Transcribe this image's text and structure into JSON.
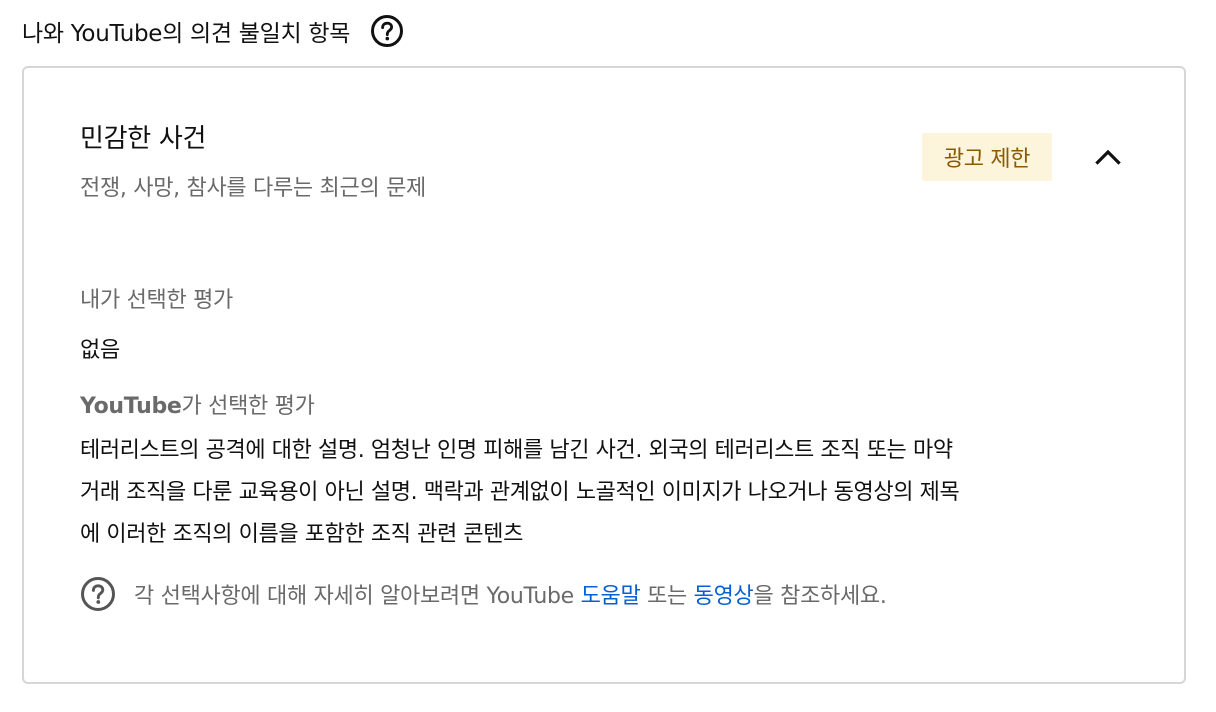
{
  "header": {
    "title": "나와 YouTube의 의견 불일치 항목",
    "help_icon": "help-circle-icon"
  },
  "issue": {
    "title": "민감한 사건",
    "subtitle": "전쟁, 사망, 참사를 다루는 최근의 문제",
    "status_badge": "광고 제한",
    "status_color": "#8a5a00",
    "status_bg": "#fdf4dc",
    "collapse_icon": "chevron-up-icon"
  },
  "my_rating": {
    "label": "내가 선택한 평가",
    "value": "없음"
  },
  "youtube_rating": {
    "label_strong": "YouTube",
    "label_rest": "가 선택한 평가",
    "description_lines": [
      "테러리스트의 공격에 대한 설명. 엄청난 인명 피해를 남긴 사건. 외국의 테러리스트 조직 또는 마약",
      "거래 조직을 다룬 교육용이 아닌 설명. 맥락과 관계없이 노골적인 이미지가 나오거나 동영상의 제목",
      "에 이러한 조직의 이름을 포함한 조직 관련 콘텐츠"
    ]
  },
  "help_note": {
    "icon": "help-circle-icon",
    "prefix": "각 선택사항에 대해 자세히 알아보려면 YouTube ",
    "link_help": "도움말",
    "middle": " 또는 ",
    "link_video": "동영상",
    "suffix": "을 참조하세요."
  },
  "colors": {
    "link": "#065fd4",
    "muted_text": "#6a6a6a",
    "border": "#d6d6d6"
  }
}
